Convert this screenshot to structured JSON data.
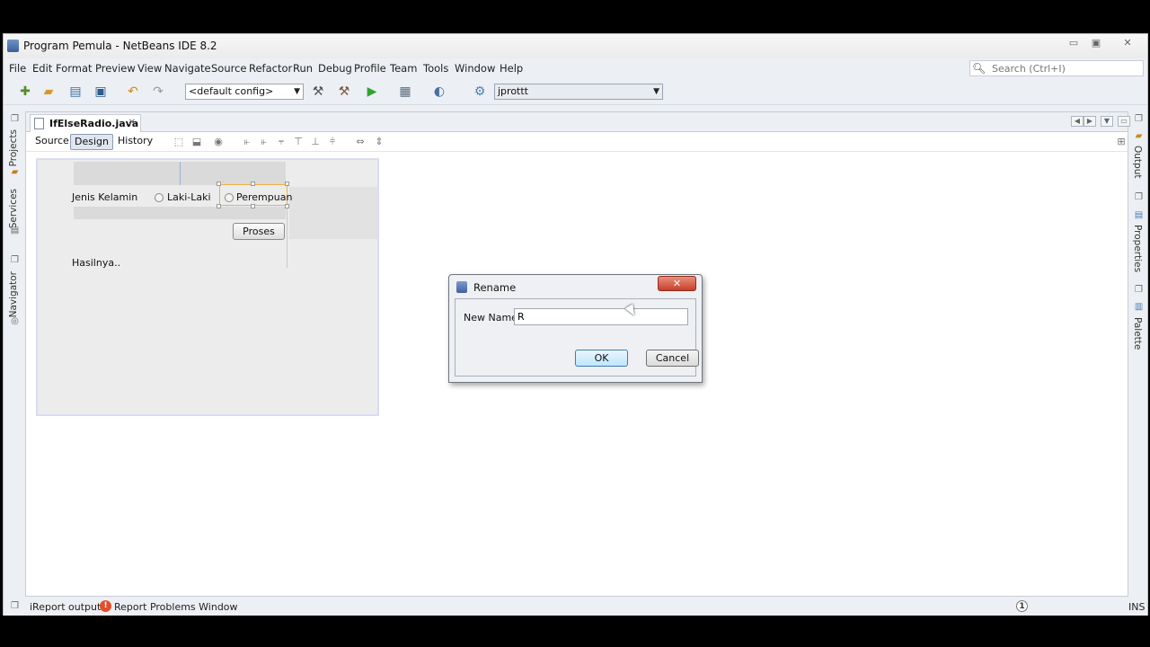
{
  "window": {
    "title": "Program Pemula - NetBeans IDE 8.2",
    "controls": {
      "minimize": "▭",
      "maximize": "▣",
      "close": "✕"
    }
  },
  "menubar": {
    "items": [
      "File",
      "Edit",
      "Format",
      "Preview",
      "View",
      "Navigate",
      "Source",
      "Refactor",
      "Run",
      "Debug",
      "Profile",
      "Team",
      "Tools",
      "Window",
      "Help"
    ],
    "search_placeholder": "Search (Ctrl+I)"
  },
  "toolbar": {
    "config": "<default config>",
    "project": "jprottt"
  },
  "side_tabs": {
    "left": [
      "Projects",
      "Services",
      "Navigator"
    ],
    "right": [
      "Output",
      "Properties",
      "Palette"
    ]
  },
  "editor": {
    "file_tab": "IfElseRadio.java",
    "modes": {
      "source": "Source",
      "design": "Design",
      "history": "History"
    },
    "active_mode": "Design"
  },
  "form": {
    "label_gender": "Jenis Kelamin",
    "radio_male": "Laki-Laki",
    "radio_female": "Perempuan",
    "button_process": "Proses",
    "label_result": "Hasilnya.."
  },
  "dialog": {
    "title": "Rename",
    "close_label": "✕",
    "field_label": "New Name:",
    "field_value": "R",
    "ok": "OK",
    "cancel": "Cancel"
  },
  "statusbar": {
    "ireport": "iReport output",
    "problems": "Report Problems Window",
    "notification_count": "1",
    "mode": "INS"
  },
  "icons": {
    "search": "search-icon",
    "run": "run-icon",
    "undo": "undo-icon",
    "redo": "redo-icon"
  }
}
